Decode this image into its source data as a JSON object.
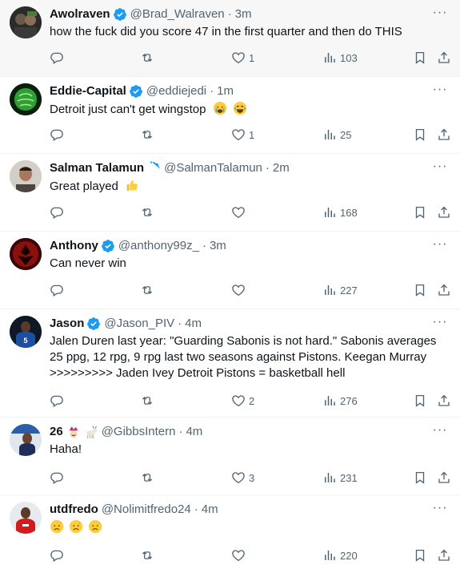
{
  "tweets": [
    {
      "name": "Awolraven",
      "verified": true,
      "handle": "@Brad_Walraven",
      "time": "3m",
      "text": "how the fuck did you score 47 in the first quarter and then do THIS",
      "replies": "",
      "retweets": "",
      "likes": "1",
      "views": "103"
    },
    {
      "name": "Eddie-Capital",
      "verified": true,
      "handle": "@eddiejedi",
      "time": "1m",
      "text": "Detroit just can't get wingstop",
      "replies": "",
      "retweets": "",
      "likes": "1",
      "views": "25"
    },
    {
      "name": "Salman Talamun",
      "verified": true,
      "handle": "@SalmanTalamun",
      "time": "2m",
      "text": "Great played",
      "replies": "",
      "retweets": "",
      "likes": "",
      "views": "168"
    },
    {
      "name": "Anthony",
      "verified": true,
      "handle": "@anthony99z_",
      "time": "3m",
      "text": "Can never win",
      "replies": "",
      "retweets": "",
      "likes": "",
      "views": "227"
    },
    {
      "name": "Jason",
      "verified": true,
      "handle": "@Jason_PIV",
      "time": "4m",
      "text": "Jalen Duren last year: \"Guarding Sabonis is not hard.\" Sabonis averages 25 ppg, 12 rpg, 9 rpg last two seasons against Pistons. Keegan Murray >>>>>>>>> Jaden Ivey Detroit Pistons = basketball hell",
      "replies": "",
      "retweets": "",
      "likes": "2",
      "views": "276"
    },
    {
      "name": "26",
      "verified": false,
      "handle": "@GibbsIntern",
      "time": "4m",
      "text": "Haha!",
      "replies": "",
      "retweets": "",
      "likes": "3",
      "views": "231"
    },
    {
      "name": "utdfredo",
      "verified": false,
      "handle": "@Nolimitfredo24",
      "time": "4m",
      "text": "",
      "replies": "",
      "retweets": "",
      "likes": "",
      "views": "220"
    }
  ],
  "colors": {
    "verified": "#1d9bf0",
    "secondary_text": "#536471",
    "highlight_bg": "#f7f7f7",
    "divider": "#eff3f4"
  },
  "icons": {
    "reply": "reply-icon",
    "retweet": "retweet-icon",
    "like": "heart-icon",
    "views": "views-icon",
    "bookmark": "bookmark-icon",
    "share": "share-icon",
    "more": "more-icon"
  }
}
